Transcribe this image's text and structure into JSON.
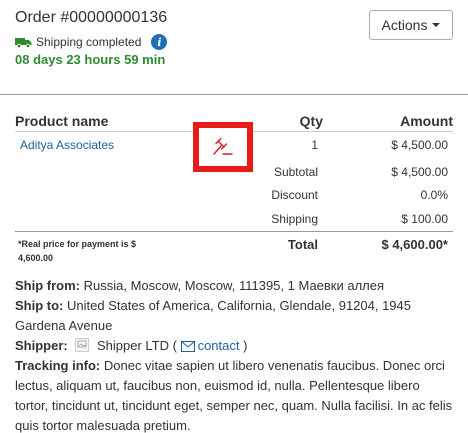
{
  "order": {
    "title": "Order #00000000136",
    "shipping_status": "Shipping completed",
    "timer": "08 days 23 hours 59 min",
    "actions_label": "Actions"
  },
  "table": {
    "headers": {
      "product": "Product name",
      "qty": "Qty",
      "amount": "Amount"
    },
    "rows": [
      {
        "product": "Aditya Associates",
        "qty": "1",
        "amount": "$ 4,500.00"
      }
    ],
    "summary": {
      "subtotal_label": "Subtotal",
      "subtotal_value": "$ 4,500.00",
      "discount_label": "Discount",
      "discount_value": "0.0%",
      "shipping_label": "Shipping",
      "shipping_value": "$ 100.00"
    },
    "note": "*Real price for payment is $ 4,600.00",
    "total_label": "Total",
    "total_value": "$ 4,600.00*"
  },
  "details": {
    "ship_from_label": "Ship from:",
    "ship_from_value": "Russia, Moscow, Moscow, 111395, 1 Маевки аллея",
    "ship_to_label": "Ship to:",
    "ship_to_value": "United States of America, California, Glendale, 91204, 1945 Gardena Avenue",
    "shipper_label": "Shipper:",
    "shipper_name": "Shipper LTD (",
    "contact_label": "contact",
    "contact_close": ")",
    "tracking_label": "Tracking info:",
    "tracking_value": "Donec vitae sapien ut libero venenatis faucibus. Donec orci lectus, aliquam ut, faucibus non, euismod id, nulla. Pellentesque libero tortor, tincidunt ut, tincidunt eget, semper nec, quam. Nulla facilisi. In ac felis quis tortor malesuada pretium."
  },
  "icons": {
    "truck": "truck-icon",
    "info": "info-icon",
    "gavel": "gavel-icon",
    "envelope": "envelope-icon",
    "shipper_logo": "no-image-icon"
  },
  "colors": {
    "timer": "#2e8b2e",
    "link": "#1f5f9e",
    "highlight_box": "#e81a1a",
    "info_icon": "#1f6fb2"
  }
}
